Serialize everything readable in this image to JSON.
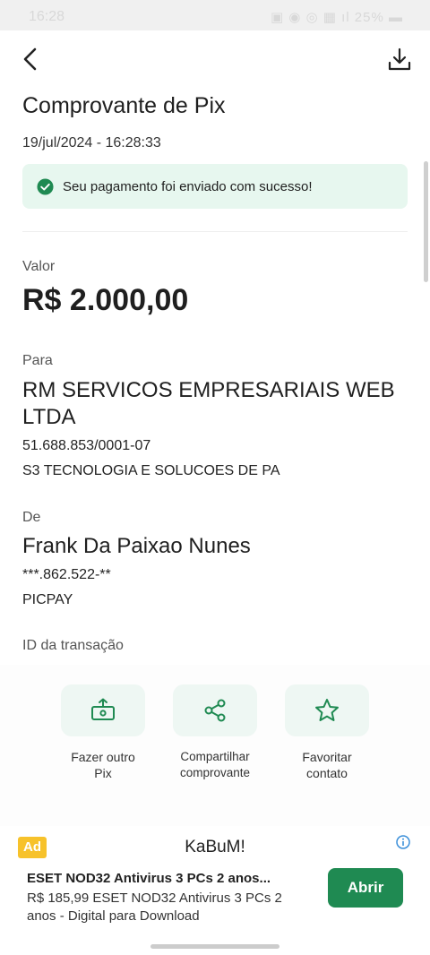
{
  "status_bar": {
    "time": "16:28",
    "right": "▣ ◉ ◎ ▦ ıl 25% ▬"
  },
  "header": {
    "title": "Comprovante de Pix",
    "date": "19/jul/2024 - 16:28:33"
  },
  "banner": {
    "text": "Seu pagamento foi enviado com sucesso!"
  },
  "value": {
    "label": "Valor",
    "amount": "R$ 2.000,00"
  },
  "recipient": {
    "label": "Para",
    "name": "RM SERVICOS EMPRESARIAIS WEB LTDA",
    "document": "51.688.853/0001-07",
    "institution": "S3 TECNOLOGIA E SOLUCOES DE PA"
  },
  "payer": {
    "label": "De",
    "name": "Frank Da Paixao Nunes",
    "document": "***.862.522-**",
    "institution": "PICPAY"
  },
  "transaction": {
    "label": "ID da transação"
  },
  "actions": [
    {
      "label_line1": "Fazer outro",
      "label_line2": "Pix",
      "icon": "send-money-icon"
    },
    {
      "label_line1": "Compartilhar",
      "label_line2": "comprovante",
      "icon": "share-icon"
    },
    {
      "label_line1": "Favoritar",
      "label_line2": "contato",
      "icon": "star-icon"
    }
  ],
  "ad": {
    "badge": "Ad",
    "brand": "KaBuM!",
    "title": "ESET NOD32 Antivirus 3 PCs 2 anos...",
    "description": "R$ 185,99 ESET NOD32 Antivirus 3 PCs 2 anos - Digital para Download",
    "button": "Abrir"
  },
  "colors": {
    "accent": "#1f8a52",
    "banner_bg": "#e7f7ef",
    "action_bg": "#eef7f3",
    "ad_badge": "#f7c22b"
  }
}
